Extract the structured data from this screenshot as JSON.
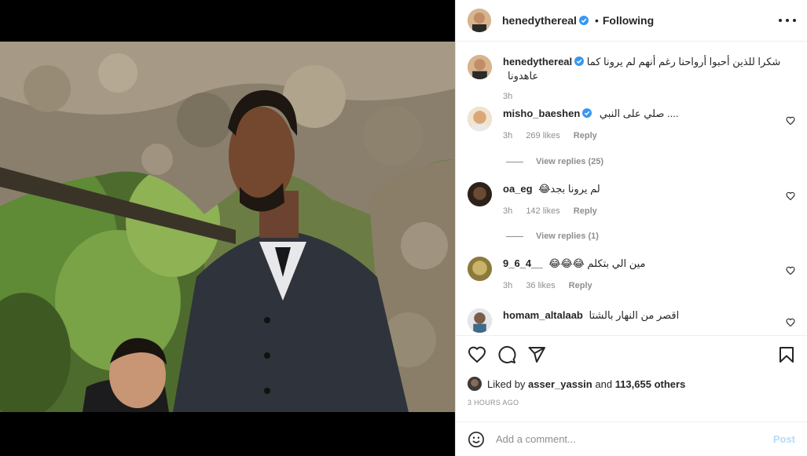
{
  "post": {
    "username": "henedythereal",
    "follow_status": "Following",
    "separator": "•",
    "caption": "شكرا للذين أحبوا أرواحنا رغم أنهم لم يرونا كما عاهدونا",
    "caption_time": "3h"
  },
  "comments": [
    {
      "username": "misho_baeshen",
      "verified": true,
      "text": ".... صلي على النبي",
      "time": "3h",
      "likes": "269 likes",
      "reply_label": "Reply",
      "view_replies": "View replies (25)"
    },
    {
      "username": "oa_eg",
      "verified": false,
      "text": "لم يرونا بجد😂",
      "time": "3h",
      "likes": "142 likes",
      "reply_label": "Reply",
      "view_replies": "View replies (1)"
    },
    {
      "username": "9_6_4__",
      "verified": false,
      "text": "مين الي بتكلم 😂😂😂",
      "time": "3h",
      "likes": "36 likes",
      "reply_label": "Reply",
      "view_replies": ""
    },
    {
      "username": "homam_altalaab",
      "verified": false,
      "text": "اقصر من النهار بالشتا",
      "time": "",
      "likes": "",
      "reply_label": "",
      "view_replies": ""
    }
  ],
  "likes_summary": {
    "prefix": "Liked by",
    "user": "asser_yassin",
    "middle": "and",
    "count": "113,655 others"
  },
  "timestamp": "3 HOURS AGO",
  "add_comment": {
    "placeholder": "Add a comment...",
    "post_label": "Post"
  },
  "icons": {
    "more": "more-options-icon",
    "like": "heart-icon",
    "comment": "comment-icon",
    "share": "share-icon",
    "save": "bookmark-icon",
    "emoji": "emoji-icon",
    "verified": "verified-badge-icon"
  },
  "colors": {
    "verified": "#3897f0",
    "post_button": "#b3dbff",
    "secondary_text": "#8e8e8e"
  }
}
